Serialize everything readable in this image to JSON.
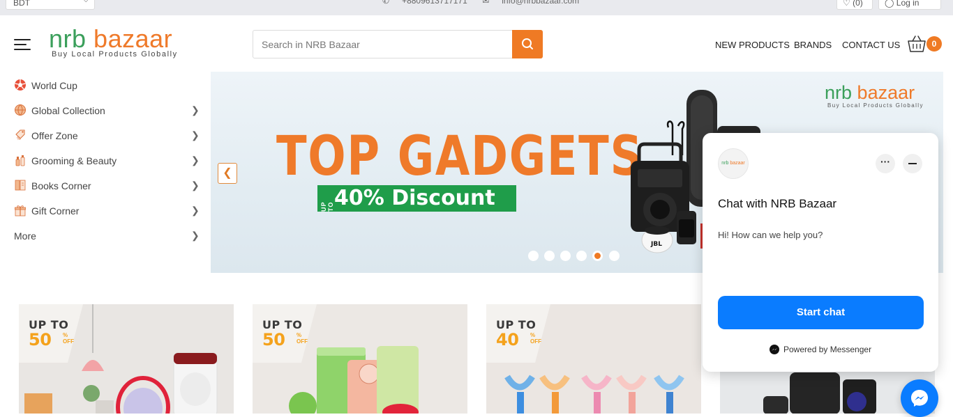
{
  "topbar": {
    "currency": "BDT",
    "phone": "+8809613717171",
    "email": "info@nrbbazaar.com",
    "wishlist_count": "(0)",
    "login_label": "Log in"
  },
  "header": {
    "logo": {
      "word1": "nrb",
      "word2": "bazaar",
      "tagline": "Buy Local Products Globally"
    },
    "search_placeholder": "Search in NRB Bazaar",
    "nav": [
      "NEW PRODUCTS",
      "BRANDS",
      "CONTACT US"
    ],
    "cart_count": "0"
  },
  "sidebar": {
    "items": [
      {
        "label": "World Cup",
        "icon": "football-icon",
        "has_arrow": false
      },
      {
        "label": "Global Collection",
        "icon": "globe-icon",
        "has_arrow": true
      },
      {
        "label": "Offer Zone",
        "icon": "offer-tag-icon",
        "has_arrow": true
      },
      {
        "label": "Grooming & Beauty",
        "icon": "beauty-icon",
        "has_arrow": true
      },
      {
        "label": "Books Corner",
        "icon": "book-icon",
        "has_arrow": true
      },
      {
        "label": "Gift Corner",
        "icon": "gift-icon",
        "has_arrow": true
      },
      {
        "label": "More",
        "icon": "",
        "has_arrow": true
      }
    ]
  },
  "banner": {
    "headline": "TOP GADGETS",
    "upto": "UP TO",
    "discount": "40% Discount",
    "logo": {
      "word1": "nrb",
      "word2": "bazaar",
      "tagline": "Buy Local Products Globally"
    },
    "slide_count": 6,
    "active_slide": 5
  },
  "tiles": [
    {
      "upto": "UP TO",
      "pct": "50",
      "sym": "%",
      "off": "OFF"
    },
    {
      "upto": "UP TO",
      "pct": "50",
      "sym": "%",
      "off": "OFF"
    },
    {
      "upto": "UP TO",
      "pct": "40",
      "sym": "%",
      "off": "OFF"
    },
    {
      "upto": "",
      "pct": "",
      "sym": "",
      "off": ""
    }
  ],
  "chat": {
    "title": "Chat with NRB Bazaar",
    "message": "Hi! How can we help you?",
    "start_label": "Start chat",
    "powered_by": "Powered by Messenger",
    "avatar_text": {
      "word1": "nrb",
      "word2": "bazaar"
    }
  },
  "colors": {
    "accent": "#ef7a24",
    "brand_green": "#3b9f5b",
    "messenger_blue": "#0a7cff"
  }
}
